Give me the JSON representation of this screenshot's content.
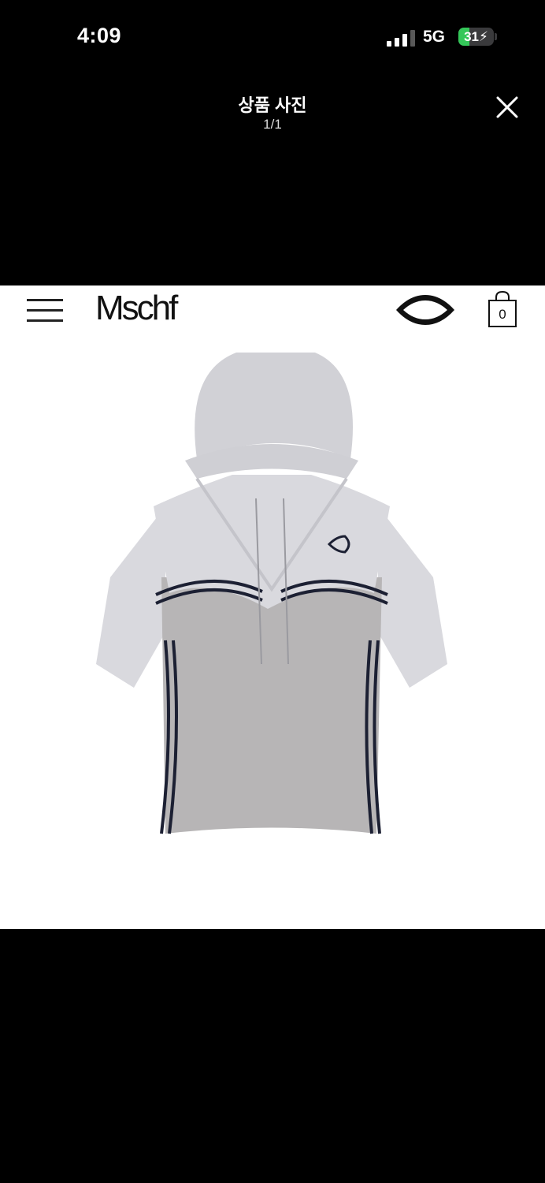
{
  "status_bar": {
    "time": "4:09",
    "network": "5G",
    "battery_level": "31",
    "battery_fraction": 0.31
  },
  "viewer": {
    "title": "상품 사진",
    "counter": "1/1"
  },
  "photo": {
    "brand": "Mschf",
    "cart_count": "0"
  },
  "colors": {
    "battery_green": "#34c759",
    "viewer_background": "#000000",
    "shirt_light": "#d9d9de",
    "shirt_body": "#b7b5b6",
    "stripe_navy": "#1c2033"
  }
}
